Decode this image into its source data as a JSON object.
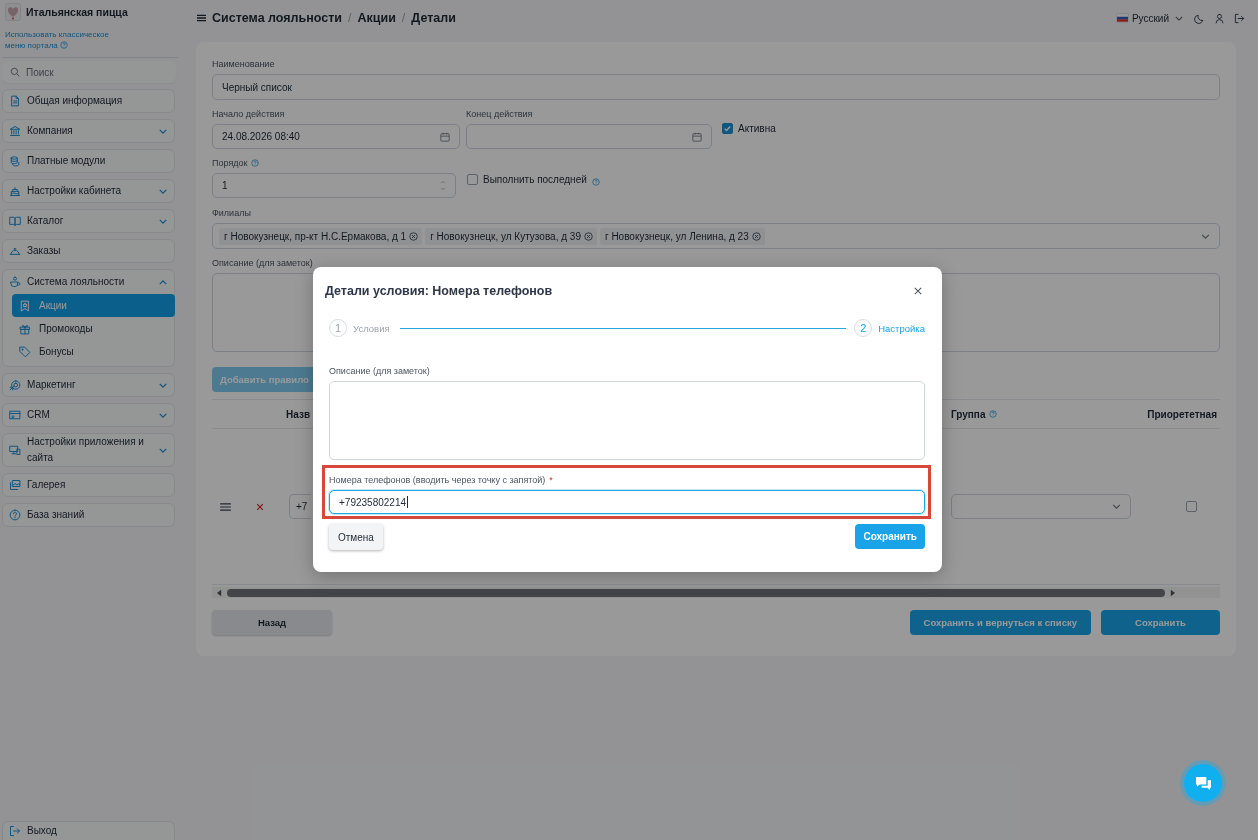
{
  "sidebar": {
    "brand": "Итальянская пицца",
    "classic_menu_link": "Использовать классическое меню портала",
    "search": {
      "placeholder": "Поиск"
    },
    "items": [
      {
        "label": "Общая информация",
        "kind": "link"
      },
      {
        "label": "Компания",
        "kind": "group",
        "expanded": false
      },
      {
        "label": "Платные модули",
        "kind": "link"
      },
      {
        "label": "Настройки кабинета",
        "kind": "group",
        "expanded": false
      },
      {
        "label": "Каталог",
        "kind": "group",
        "expanded": false
      },
      {
        "label": "Заказы",
        "kind": "link"
      },
      {
        "label": "Система лояльности",
        "kind": "group",
        "expanded": true,
        "children": [
          {
            "label": "Акции",
            "selected": true
          },
          {
            "label": "Промокоды",
            "selected": false
          },
          {
            "label": "Бонусы",
            "selected": false
          }
        ]
      },
      {
        "label": "Маркетинг",
        "kind": "group",
        "expanded": false
      },
      {
        "label": "CRM",
        "kind": "group",
        "expanded": false
      },
      {
        "label": "Настройки приложения и сайта",
        "kind": "group",
        "expanded": false
      },
      {
        "label": "Галерея",
        "kind": "link"
      },
      {
        "label": "База знаний",
        "kind": "link"
      }
    ],
    "logout": "Выход"
  },
  "header": {
    "breadcrumb": [
      "Система лояльности",
      "Акции",
      "Детали"
    ],
    "separator": "/",
    "language": "Русский"
  },
  "form": {
    "name": {
      "label": "Наименование",
      "value": "Черный список"
    },
    "start": {
      "label": "Начало действия",
      "value": "24.08.2026 08:40"
    },
    "end": {
      "label": "Конец действия"
    },
    "active": {
      "label": "Активна",
      "checked": true
    },
    "order": {
      "label": "Порядок",
      "value": "1"
    },
    "run_last": {
      "label": "Выполнить последней",
      "checked": false
    },
    "branches": {
      "label": "Филиалы",
      "chips": [
        "г Новокузнецк, пр-кт Н.С.Ермакова, д 1",
        "г Новокузнецк, ул Кутузова, д 39",
        "г Новокузнецк, ул Ленина, д 23"
      ]
    },
    "description": {
      "label": "Описание (для заметок)"
    },
    "add_rule": {
      "label": "Добавить правило",
      "disabled": true
    }
  },
  "rules_table": {
    "columns": [
      {
        "label": "Назв"
      },
      {
        "label": "Группа"
      },
      {
        "label": "Приорететная"
      }
    ],
    "rows": [
      {
        "value": "+7",
        "checked": false
      }
    ]
  },
  "footer_buttons": [
    {
      "label": "Назад",
      "kind": "secondary"
    },
    {
      "label": "Сохранить и вернуться к списку",
      "kind": "primary"
    },
    {
      "label": "Сохранить",
      "kind": "primary"
    }
  ],
  "modal": {
    "title": "Детали условия: Номера телефонов",
    "steps": [
      {
        "number": "1",
        "label": "Условия",
        "selected": false
      },
      {
        "number": "2",
        "label": "Настройка",
        "selected": true
      }
    ],
    "description": {
      "label": "Описание (для заметок)"
    },
    "phones": {
      "label": "Номера телефонов (вводить через точку с запятой)",
      "required_mark": "*",
      "value": "+79235802214",
      "focused": true,
      "highlighted": true
    },
    "buttons": [
      {
        "label": "Отмена",
        "kind": "secondary"
      },
      {
        "label": "Сохранить",
        "kind": "primary"
      }
    ]
  }
}
